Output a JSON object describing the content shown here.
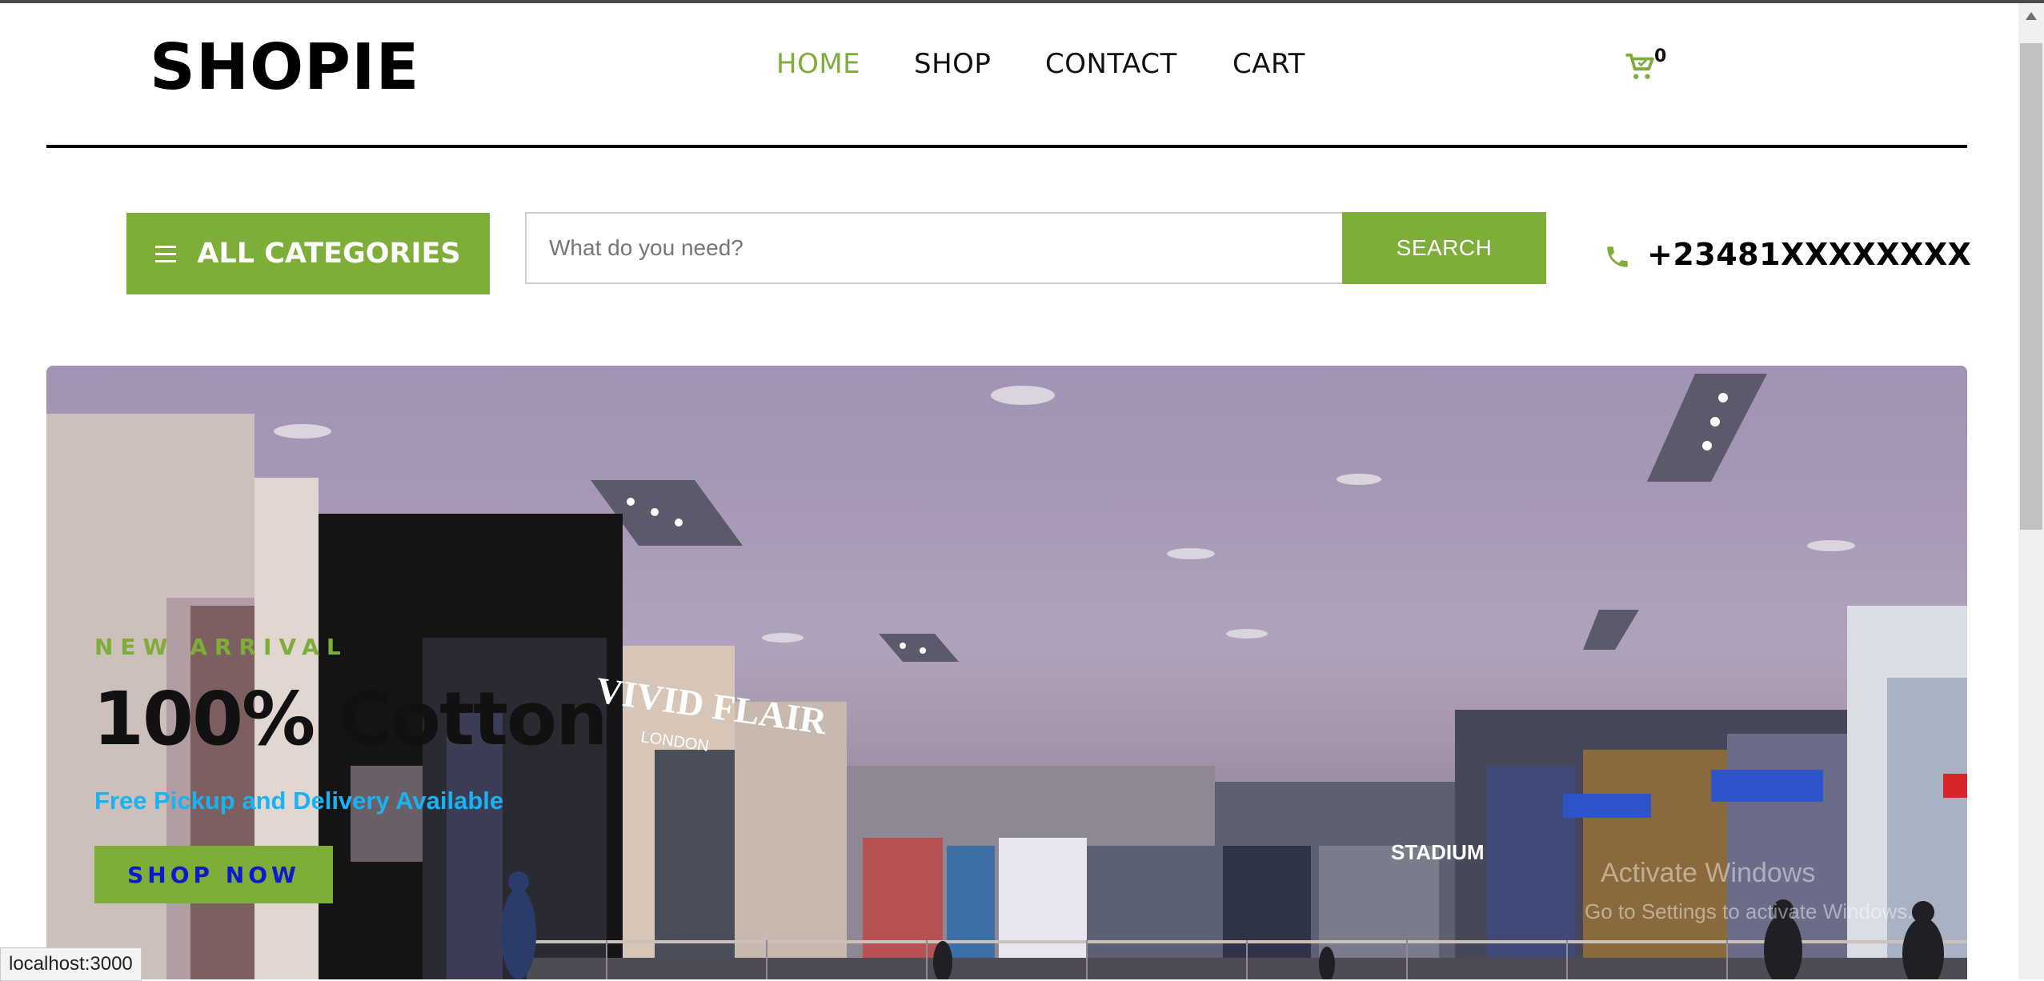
{
  "header": {
    "logo": "SHOPIE",
    "nav": [
      {
        "label": "HOME",
        "active": true
      },
      {
        "label": "SHOP",
        "active": false
      },
      {
        "label": "CONTACT",
        "active": false
      },
      {
        "label": "CART",
        "active": false
      }
    ],
    "cart_count": "0",
    "cart_icon": "cart-icon"
  },
  "toolbar": {
    "categories_label": "ALL CATEGORIES",
    "categories_icon": "menu-icon",
    "search_placeholder": "What do you need?",
    "search_value": "",
    "search_button": "SEARCH",
    "phone_icon": "phone-icon",
    "phone": "+23481XXXXXXXX"
  },
  "hero": {
    "eyebrow": "NEW ARRIVAL",
    "title": "100% Cotton",
    "subtitle": "Free Pickup and Delivery Available",
    "button": "SHOP NOW",
    "signs": [
      "VIVID FLAIR",
      "LONDON",
      "STADIUM"
    ]
  },
  "overlay": {
    "watermark_title": "Activate Windows",
    "watermark_sub": "Go to Settings to activate Windows."
  },
  "statusbar": {
    "url": "localhost:3000"
  },
  "colors": {
    "accent": "#7fad39",
    "subtitle": "#1ab2f0",
    "button_text": "#0a1acc"
  }
}
